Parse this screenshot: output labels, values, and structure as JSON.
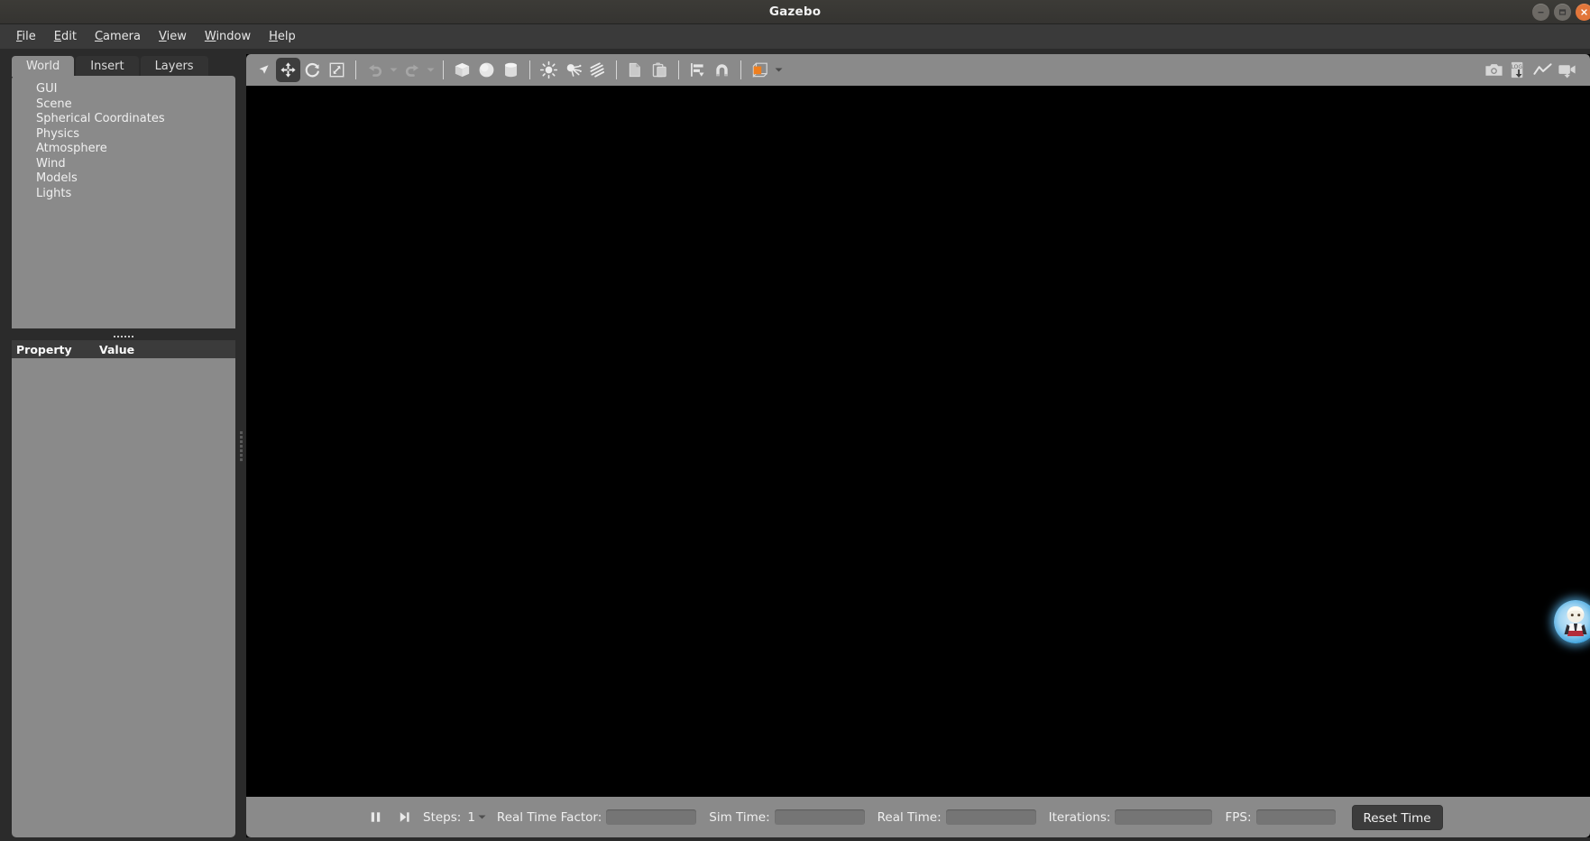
{
  "window": {
    "title": "Gazebo",
    "controls": [
      {
        "name": "minimize",
        "glyph": "minimize-icon"
      },
      {
        "name": "maximize",
        "glyph": "maximize-icon"
      },
      {
        "name": "close",
        "glyph": "close-icon"
      }
    ],
    "accent_close": "#e2763a",
    "titlebar_bg": "#3a3936"
  },
  "menu": {
    "items": [
      {
        "label": "File",
        "mnemonic": "F"
      },
      {
        "label": "Edit",
        "mnemonic": "E"
      },
      {
        "label": "Camera",
        "mnemonic": "C"
      },
      {
        "label": "View",
        "mnemonic": "V"
      },
      {
        "label": "Window",
        "mnemonic": "W"
      },
      {
        "label": "Help",
        "mnemonic": "H"
      }
    ]
  },
  "left_panel": {
    "tabs": [
      {
        "label": "World",
        "active": true
      },
      {
        "label": "Insert",
        "active": false
      },
      {
        "label": "Layers",
        "active": false
      }
    ],
    "tree_items": [
      {
        "label": "GUI"
      },
      {
        "label": "Scene"
      },
      {
        "label": "Spherical Coordinates"
      },
      {
        "label": "Physics"
      },
      {
        "label": "Atmosphere"
      },
      {
        "label": "Wind"
      },
      {
        "label": "Models"
      },
      {
        "label": "Lights"
      }
    ],
    "property_table": {
      "columns": [
        "Property",
        "Value"
      ],
      "rows": []
    }
  },
  "toolbar": {
    "left_tools": [
      {
        "name": "select-mode",
        "icon": "cursor-arrow-icon",
        "active": false,
        "enabled": true
      },
      {
        "name": "translate-mode",
        "icon": "move-arrows-icon",
        "active": true,
        "enabled": true
      },
      {
        "name": "rotate-mode",
        "icon": "rotate-icon",
        "active": false,
        "enabled": true
      },
      {
        "name": "scale-mode",
        "icon": "scale-icon",
        "active": false,
        "enabled": true
      }
    ],
    "history_tools": [
      {
        "name": "undo",
        "icon": "undo-arrow-icon",
        "enabled": false,
        "has_caret": true
      },
      {
        "name": "redo",
        "icon": "redo-arrow-icon",
        "enabled": false,
        "has_caret": true
      }
    ],
    "shape_tools": [
      {
        "name": "insert-box",
        "icon": "box-icon"
      },
      {
        "name": "insert-sphere",
        "icon": "sphere-icon"
      },
      {
        "name": "insert-cylinder",
        "icon": "cylinder-icon"
      }
    ],
    "light_tools": [
      {
        "name": "insert-point-light",
        "icon": "point-light-icon"
      },
      {
        "name": "insert-spot-light",
        "icon": "spot-light-icon"
      },
      {
        "name": "insert-directional-light",
        "icon": "directional-light-icon"
      }
    ],
    "clipboard_tools": [
      {
        "name": "copy",
        "icon": "copy-icon"
      },
      {
        "name": "paste",
        "icon": "paste-icon"
      }
    ],
    "arrange_tools": [
      {
        "name": "align",
        "icon": "align-icon",
        "has_caret": false
      },
      {
        "name": "snap",
        "icon": "magnet-snap-icon",
        "has_caret": false
      }
    ],
    "view_tools": [
      {
        "name": "view-transparency",
        "icon": "wireframe-box-icon",
        "accent": "#ef7f1f",
        "has_caret": true
      }
    ],
    "right_tools": [
      {
        "name": "screenshot",
        "icon": "camera-icon"
      },
      {
        "name": "save-log",
        "icon": "log-download-icon",
        "badge": "LOG"
      },
      {
        "name": "plot",
        "icon": "plot-line-icon"
      },
      {
        "name": "record-video",
        "icon": "video-camera-icon"
      }
    ]
  },
  "viewport": {
    "background": "#000000",
    "avatar": {
      "name": "user-avatar",
      "visible": true
    }
  },
  "statusbar": {
    "playback": [
      {
        "name": "pause",
        "icon": "pause-icon"
      },
      {
        "name": "step",
        "icon": "step-forward-icon"
      }
    ],
    "steps_label": "Steps:",
    "steps_value": "1",
    "fields": [
      {
        "name": "real-time-factor",
        "label": "Real Time Factor:",
        "value": "",
        "width_class": "w-rtf"
      },
      {
        "name": "sim-time",
        "label": "Sim Time:",
        "value": "",
        "width_class": "w-sim"
      },
      {
        "name": "real-time",
        "label": "Real Time:",
        "value": "",
        "width_class": "w-real"
      },
      {
        "name": "iterations",
        "label": "Iterations:",
        "value": "",
        "width_class": "w-iter"
      },
      {
        "name": "fps",
        "label": "FPS:",
        "value": "",
        "width_class": "w-fps"
      }
    ],
    "reset_button": "Reset Time"
  },
  "colors": {
    "panel_bg": "#8a8a8a",
    "app_bg": "#2b2b2b",
    "menu_bg": "#3a3a3a",
    "header_bg": "#3b3b3b",
    "text": "#f0f0f0",
    "accent_orange": "#ef7f1f"
  }
}
